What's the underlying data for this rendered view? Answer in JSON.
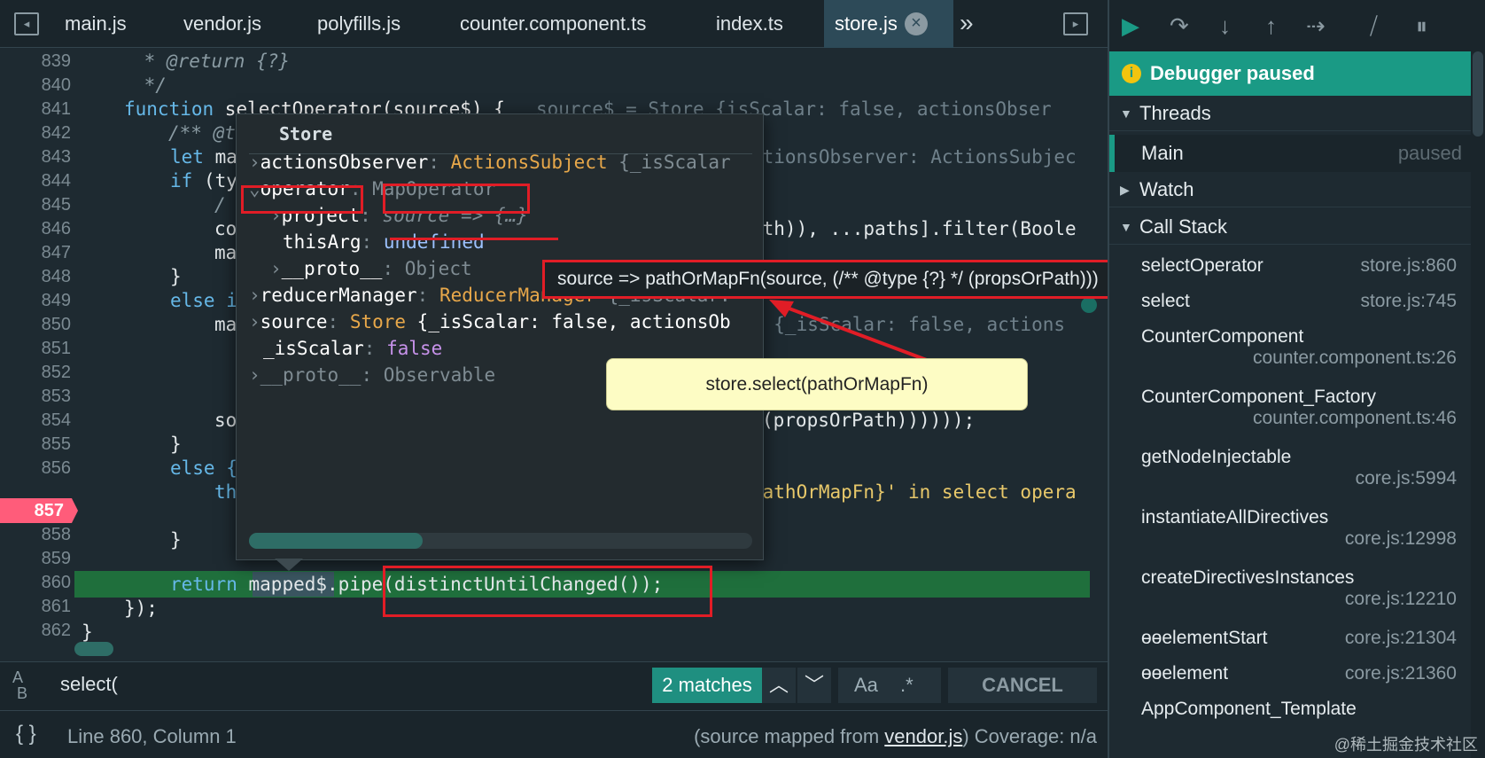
{
  "tabs": [
    {
      "label": "main.js"
    },
    {
      "label": "vendor.js"
    },
    {
      "label": "polyfills.js"
    },
    {
      "label": "counter.component.ts"
    },
    {
      "label": "index.ts"
    },
    {
      "label": "store.js",
      "active": true
    }
  ],
  "editor": {
    "line_numbers": [
      "839",
      "840",
      "841",
      "842",
      "843",
      "844",
      "845",
      "846",
      "847",
      "848",
      "849",
      "850",
      "851",
      "852",
      "853",
      "854",
      "855",
      "856",
      "857",
      "858",
      "859",
      "860",
      "861",
      "862"
    ],
    "breakpoint_line": "857",
    "current_line": "860",
    "code": {
      "l839": " * @return {?}",
      "l840": " */",
      "l841_kw": "function",
      "l841_rest": " selectOperator(source$) {",
      "l841_inline": "source$ = Store {isScalar: false, actionsObser",
      "l842": "/** @t",
      "l843_kw": "let",
      "l843_rest": " ma",
      "l843_inline": "ctionsObserver: ActionsSubjec",
      "l844_kw": "if",
      "l844_rest": " (ty",
      "l845": "/",
      "l846": "co",
      "l846_tail": "ath)), ...paths].filter(Boole",
      "l847": "ma",
      "l848": "}",
      "l849_kw": "else i",
      "l850": "ma",
      "l850_inline": "e {_isScalar: false, actions",
      "l854": "so",
      "l854_tail": "(propsOrPath))))));",
      "l855": "}",
      "l856_kw": "else {",
      "l857": "th",
      "l857_tail": "pathOrMapFn}' in select opera",
      "l859": "}",
      "l860_kw": "return",
      "l860_var": "mapped$",
      "l860_rest": ".pipe(distinctUntilChanged());",
      "l861": "});",
      "l862": "}"
    }
  },
  "popover": {
    "title": "Store",
    "rows": [
      {
        "key": "actionsObserver",
        "type": "ActionsSubject",
        "rest": " {_isScalar"
      },
      {
        "key": "operator",
        "type": "MapOperator"
      },
      {
        "key": "project",
        "value": "source => {…}"
      },
      {
        "key": "thisArg",
        "value": "undefined"
      },
      {
        "key": "__proto__",
        "value": "Object"
      },
      {
        "key": "reducerManager",
        "type": "ReducerManager",
        "rest": " {_isScalar:"
      },
      {
        "key": "source",
        "type": "Store",
        "rest": " {_isScalar: false, actionsOb"
      },
      {
        "key": "_isScalar",
        "value": "false"
      },
      {
        "key": "__proto__",
        "value": "Observable"
      }
    ]
  },
  "tooltip": {
    "text": "source => pathOrMapFn(source, (/** @type {?} */ (propsOrPath)))"
  },
  "note": {
    "text": "store.select(pathOrMapFn)"
  },
  "search": {
    "value": "select(",
    "matches": "2 matches",
    "case_label": "Aa",
    "regex_label": ".*",
    "cancel_label": "CANCEL"
  },
  "status": {
    "position": "Line 860, Column 1",
    "source_mapped_prefix": "(source mapped from ",
    "source_file": "vendor.js",
    "source_mapped_suffix": ")",
    "coverage": "Coverage: n/a"
  },
  "debugger": {
    "paused_label": "Debugger paused",
    "threads_label": "Threads",
    "thread_name": "Main",
    "thread_status": "paused",
    "watch_label": "Watch",
    "callstack_label": "Call Stack",
    "frames": [
      {
        "name": "selectOperator",
        "location": "store.js:860"
      },
      {
        "name": "select",
        "location": "store.js:745"
      },
      {
        "name": "CounterComponent",
        "location": "counter.component.ts:26"
      },
      {
        "name": "CounterComponent_Factory",
        "location": "counter.component.ts:46"
      },
      {
        "name": "getNodeInjectable",
        "location": "core.js:5994"
      },
      {
        "name": "instantiateAllDirectives",
        "location": "core.js:12998"
      },
      {
        "name": "createDirectivesInstances",
        "location": "core.js:12210"
      },
      {
        "name": "ɵɵelementStart",
        "location": "core.js:21304"
      },
      {
        "name": "ɵɵelement",
        "location": "core.js:21360"
      },
      {
        "name": "AppComponent_Template",
        "location": ""
      }
    ]
  },
  "watermark": "@稀土掘金技术社区",
  "colors": {
    "accent": "#1a9a85",
    "annotation_red": "#e11d26",
    "breakpoint": "#ff5c7a",
    "exec_line": "#1f6f3c"
  }
}
